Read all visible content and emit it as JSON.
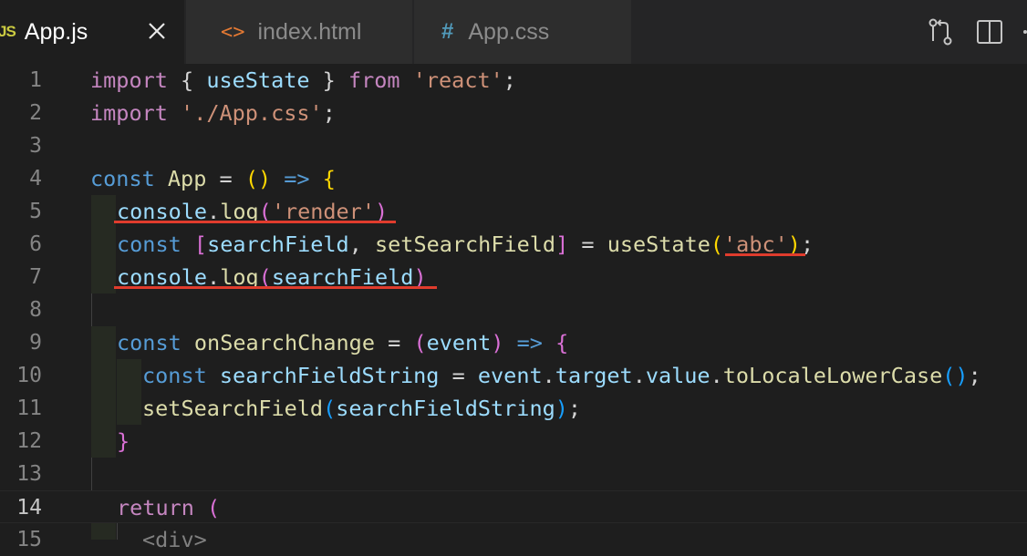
{
  "tabs": [
    {
      "icon": "JS",
      "label": "App.js",
      "active": true
    },
    {
      "icon": "<>",
      "label": "index.html",
      "active": false
    },
    {
      "icon": "#",
      "label": "App.css",
      "active": false
    }
  ],
  "toolbar": {
    "icons": [
      "compare-changes-icon",
      "split-editor-icon",
      "more-actions-icon"
    ]
  },
  "editor": {
    "current_line": 14,
    "line_numbers": [
      "1",
      "2",
      "3",
      "4",
      "5",
      "6",
      "7",
      "8",
      "9",
      "10",
      "11",
      "12",
      "13",
      "14",
      "15"
    ],
    "lines": {
      "l1": {
        "a": "import",
        "b": " { ",
        "c": "useState",
        "d": " } ",
        "e": "from",
        "f": " ",
        "g": "'react'",
        "h": ";"
      },
      "l2": {
        "a": "import",
        "b": " ",
        "c": "'./App.css'",
        "d": ";"
      },
      "l4": {
        "a": "const",
        "b": " ",
        "c": "App",
        "d": " = ",
        "e": "()",
        "f": " ",
        "g": "=>",
        "h": " ",
        "i": "{"
      },
      "l5": {
        "a": "console",
        "b": ".",
        "c": "log",
        "d": "(",
        "e": "'render'",
        "f": ")"
      },
      "l6": {
        "a": "const",
        "b": " ",
        "c": "[",
        "d": "searchField",
        "e": ", ",
        "f": "setSearchField",
        "g": "]",
        "h": " = ",
        "i": "useState",
        "j": "(",
        "k": "'abc'",
        "l": ")",
        "m": ";"
      },
      "l7": {
        "a": "console",
        "b": ".",
        "c": "log",
        "d": "(",
        "e": "searchField",
        "f": ")"
      },
      "l9": {
        "a": "const",
        "b": " ",
        "c": "onSearchChange",
        "d": " = ",
        "e": "(",
        "f": "event",
        "g": ")",
        "h": " ",
        "i": "=>",
        "j": " ",
        "k": "{"
      },
      "l10": {
        "a": "const",
        "b": " ",
        "c": "searchFieldString",
        "d": " = ",
        "e": "event",
        "f": ".",
        "g": "target",
        "h": ".",
        "i": "value",
        "j": ".",
        "k": "toLocaleLowerCase",
        "l": "()",
        "m": ";"
      },
      "l11": {
        "a": "setSearchField",
        "b": "(",
        "c": "searchFieldString",
        "d": ")",
        "e": ";"
      },
      "l12": {
        "a": "}"
      },
      "l14": {
        "a": "return",
        "b": " ",
        "c": "("
      },
      "l15": {
        "a": "<div>"
      }
    }
  },
  "colors": {
    "background": "#1e1e1e",
    "underline": "#e03c2d",
    "keyword": "#569cd6",
    "control": "#c586c0",
    "variable": "#9cdcfe",
    "function": "#dcdcaa",
    "string": "#ce9178"
  }
}
